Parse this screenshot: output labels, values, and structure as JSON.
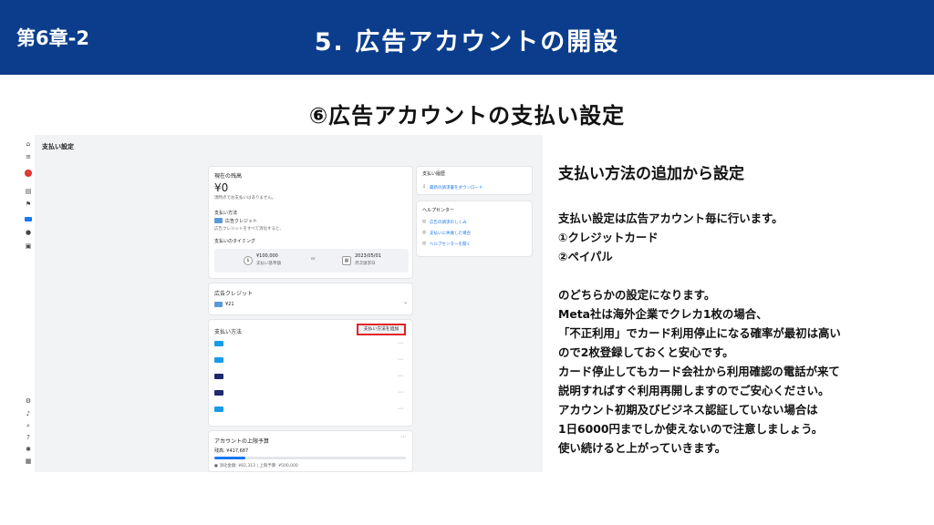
{
  "header": {
    "chapter": "第6章-2",
    "title": "5. 広告アカウントの開設"
  },
  "subtitle": "⑥広告アカウントの支払い設定",
  "screenshot": {
    "page_title": "支払い設定",
    "balance_card": {
      "heading": "現在の残高",
      "amount": "¥0",
      "note": "現時点でお支払いはありません。",
      "method_label": "支払い方法",
      "method_badge": "広告クレジット",
      "method_note": "広告クレジットをすべて消化すると、",
      "timing_label": "支払いのタイミング",
      "threshold_value": "¥100,000",
      "threshold_label": "支払い基準額",
      "or_label": "or",
      "date_value": "2023/05/01",
      "date_label": "月次請求日"
    },
    "credit_card": {
      "heading": "広告クレジット",
      "value": "¥21"
    },
    "methods_card": {
      "heading": "支払い方法",
      "add_button": "支払い方法を追加",
      "rows": [
        {
          "icon": "visa-card-icon",
          "color": "#1a9be8"
        },
        {
          "icon": "visa-card-icon",
          "color": "#1a9be8"
        },
        {
          "icon": "visa-card-icon",
          "color": "#1f2a6b"
        },
        {
          "icon": "visa-card-icon",
          "color": "#1f2a6b"
        },
        {
          "icon": "visa-card-icon",
          "color": "#1a9be8"
        }
      ]
    },
    "limit_card": {
      "heading": "アカウントの上限予算",
      "remaining": "残高: ¥417,687",
      "used_fraction": 0.16,
      "footer": "● 消化金額: ¥82,313 | 上限予算: ¥500,000"
    },
    "history_card": {
      "heading": "支払い履歴",
      "link": "最新の請求書をダウンロード"
    },
    "help_card": {
      "heading": "ヘルプセンター",
      "links": [
        "広告の請求のしくみ",
        "支払いに失敗した場合",
        "ヘルプセンターを開く"
      ]
    }
  },
  "explanation": {
    "heading": "支払い方法の追加から設定",
    "lines": [
      "支払い設定は広告アカウント毎に行います。",
      "①クレジットカード",
      "②ペイパル",
      "",
      "のどちらかの設定になります。",
      "Meta社は海外企業でクレカ1枚の場合、",
      "「不正利用」でカード利用停止になる確率が最初は高い",
      "ので2枚登録しておくと安心です。",
      "カード停止してもカード会社から利用確認の電話が来て",
      "説明すればすぐ利用再開しますのでご安心ください。",
      "アカウント初期及びビジネス認証していない場合は",
      "1日6000円までしか使えないので注意しましょう。",
      "使い続けると上がっていきます。"
    ]
  }
}
